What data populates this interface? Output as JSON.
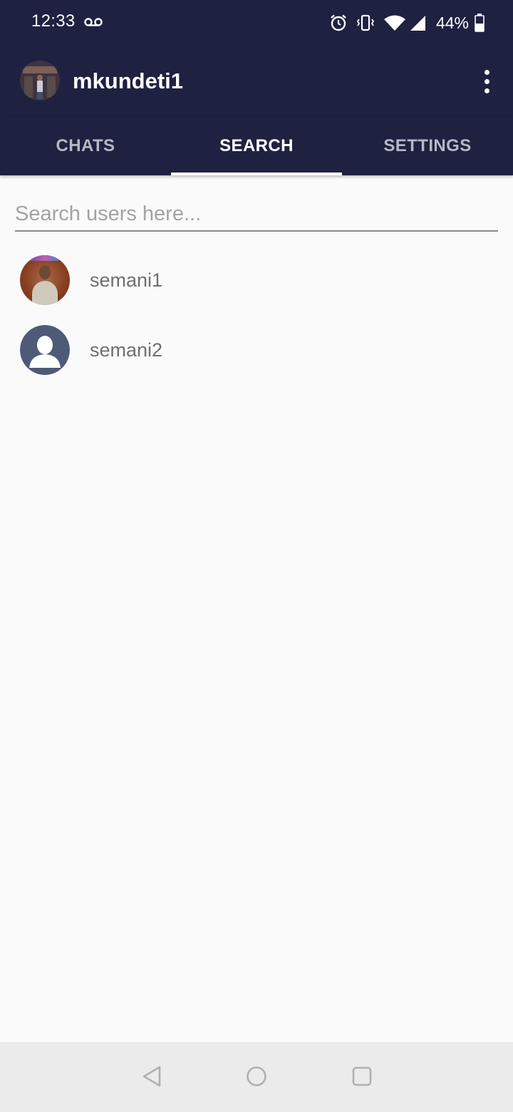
{
  "status_bar": {
    "time": "12:33",
    "battery_percent": "44%",
    "icons": [
      "voicemail-icon",
      "alarm-icon",
      "vibrate-icon",
      "wifi-icon",
      "cell-signal-icon",
      "battery-icon"
    ]
  },
  "app_bar": {
    "title": "mkundeti1",
    "menu_icon": "more-vert-icon"
  },
  "tabs": [
    {
      "label": "CHATS",
      "active": false
    },
    {
      "label": "SEARCH",
      "active": true
    },
    {
      "label": "SETTINGS",
      "active": false
    }
  ],
  "search": {
    "placeholder": "Search users here...",
    "value": ""
  },
  "users": [
    {
      "name": "semani1",
      "avatar": "photo"
    },
    {
      "name": "semani2",
      "avatar": "default-person-icon"
    }
  ],
  "colors": {
    "primary": "#1e2140",
    "background": "#fafafa",
    "tab_inactive": "#b6b8c4",
    "default_avatar": "#4d5a78"
  }
}
